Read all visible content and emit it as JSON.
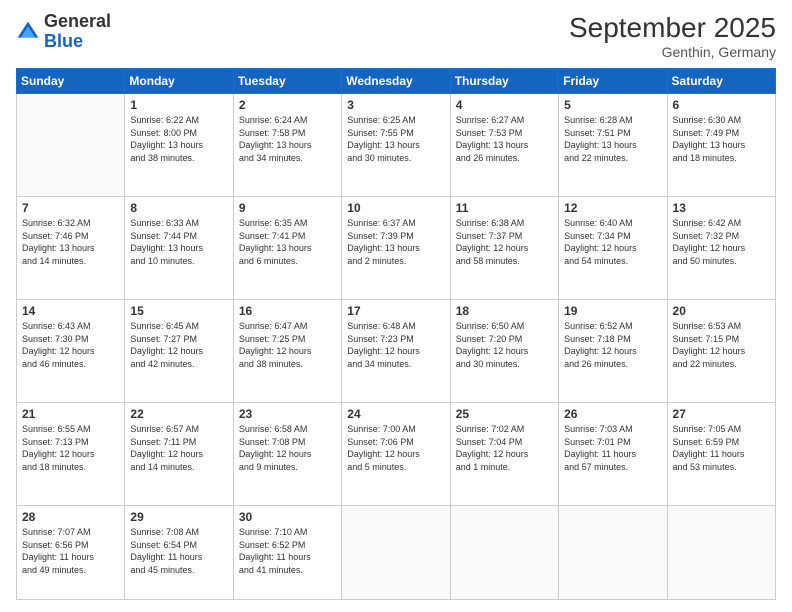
{
  "header": {
    "logo_general": "General",
    "logo_blue": "Blue",
    "month": "September 2025",
    "location": "Genthin, Germany"
  },
  "weekdays": [
    "Sunday",
    "Monday",
    "Tuesday",
    "Wednesday",
    "Thursday",
    "Friday",
    "Saturday"
  ],
  "weeks": [
    [
      {
        "day": "",
        "text": ""
      },
      {
        "day": "1",
        "text": "Sunrise: 6:22 AM\nSunset: 8:00 PM\nDaylight: 13 hours\nand 38 minutes."
      },
      {
        "day": "2",
        "text": "Sunrise: 6:24 AM\nSunset: 7:58 PM\nDaylight: 13 hours\nand 34 minutes."
      },
      {
        "day": "3",
        "text": "Sunrise: 6:25 AM\nSunset: 7:55 PM\nDaylight: 13 hours\nand 30 minutes."
      },
      {
        "day": "4",
        "text": "Sunrise: 6:27 AM\nSunset: 7:53 PM\nDaylight: 13 hours\nand 26 minutes."
      },
      {
        "day": "5",
        "text": "Sunrise: 6:28 AM\nSunset: 7:51 PM\nDaylight: 13 hours\nand 22 minutes."
      },
      {
        "day": "6",
        "text": "Sunrise: 6:30 AM\nSunset: 7:49 PM\nDaylight: 13 hours\nand 18 minutes."
      }
    ],
    [
      {
        "day": "7",
        "text": "Sunrise: 6:32 AM\nSunset: 7:46 PM\nDaylight: 13 hours\nand 14 minutes."
      },
      {
        "day": "8",
        "text": "Sunrise: 6:33 AM\nSunset: 7:44 PM\nDaylight: 13 hours\nand 10 minutes."
      },
      {
        "day": "9",
        "text": "Sunrise: 6:35 AM\nSunset: 7:41 PM\nDaylight: 13 hours\nand 6 minutes."
      },
      {
        "day": "10",
        "text": "Sunrise: 6:37 AM\nSunset: 7:39 PM\nDaylight: 13 hours\nand 2 minutes."
      },
      {
        "day": "11",
        "text": "Sunrise: 6:38 AM\nSunset: 7:37 PM\nDaylight: 12 hours\nand 58 minutes."
      },
      {
        "day": "12",
        "text": "Sunrise: 6:40 AM\nSunset: 7:34 PM\nDaylight: 12 hours\nand 54 minutes."
      },
      {
        "day": "13",
        "text": "Sunrise: 6:42 AM\nSunset: 7:32 PM\nDaylight: 12 hours\nand 50 minutes."
      }
    ],
    [
      {
        "day": "14",
        "text": "Sunrise: 6:43 AM\nSunset: 7:30 PM\nDaylight: 12 hours\nand 46 minutes."
      },
      {
        "day": "15",
        "text": "Sunrise: 6:45 AM\nSunset: 7:27 PM\nDaylight: 12 hours\nand 42 minutes."
      },
      {
        "day": "16",
        "text": "Sunrise: 6:47 AM\nSunset: 7:25 PM\nDaylight: 12 hours\nand 38 minutes."
      },
      {
        "day": "17",
        "text": "Sunrise: 6:48 AM\nSunset: 7:23 PM\nDaylight: 12 hours\nand 34 minutes."
      },
      {
        "day": "18",
        "text": "Sunrise: 6:50 AM\nSunset: 7:20 PM\nDaylight: 12 hours\nand 30 minutes."
      },
      {
        "day": "19",
        "text": "Sunrise: 6:52 AM\nSunset: 7:18 PM\nDaylight: 12 hours\nand 26 minutes."
      },
      {
        "day": "20",
        "text": "Sunrise: 6:53 AM\nSunset: 7:15 PM\nDaylight: 12 hours\nand 22 minutes."
      }
    ],
    [
      {
        "day": "21",
        "text": "Sunrise: 6:55 AM\nSunset: 7:13 PM\nDaylight: 12 hours\nand 18 minutes."
      },
      {
        "day": "22",
        "text": "Sunrise: 6:57 AM\nSunset: 7:11 PM\nDaylight: 12 hours\nand 14 minutes."
      },
      {
        "day": "23",
        "text": "Sunrise: 6:58 AM\nSunset: 7:08 PM\nDaylight: 12 hours\nand 9 minutes."
      },
      {
        "day": "24",
        "text": "Sunrise: 7:00 AM\nSunset: 7:06 PM\nDaylight: 12 hours\nand 5 minutes."
      },
      {
        "day": "25",
        "text": "Sunrise: 7:02 AM\nSunset: 7:04 PM\nDaylight: 12 hours\nand 1 minute."
      },
      {
        "day": "26",
        "text": "Sunrise: 7:03 AM\nSunset: 7:01 PM\nDaylight: 11 hours\nand 57 minutes."
      },
      {
        "day": "27",
        "text": "Sunrise: 7:05 AM\nSunset: 6:59 PM\nDaylight: 11 hours\nand 53 minutes."
      }
    ],
    [
      {
        "day": "28",
        "text": "Sunrise: 7:07 AM\nSunset: 6:56 PM\nDaylight: 11 hours\nand 49 minutes."
      },
      {
        "day": "29",
        "text": "Sunrise: 7:08 AM\nSunset: 6:54 PM\nDaylight: 11 hours\nand 45 minutes."
      },
      {
        "day": "30",
        "text": "Sunrise: 7:10 AM\nSunset: 6:52 PM\nDaylight: 11 hours\nand 41 minutes."
      },
      {
        "day": "",
        "text": ""
      },
      {
        "day": "",
        "text": ""
      },
      {
        "day": "",
        "text": ""
      },
      {
        "day": "",
        "text": ""
      }
    ]
  ]
}
